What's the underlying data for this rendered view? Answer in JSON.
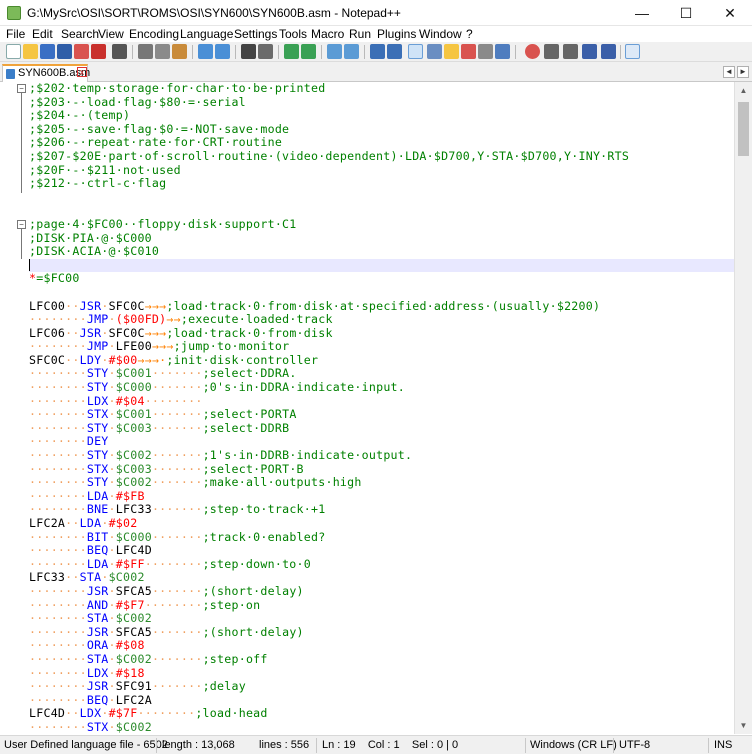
{
  "window": {
    "title": "G:\\MySrc\\OSI\\SORT\\ROMS\\OSI\\SYN600\\SYN600B.asm - Notepad++",
    "minimize": "—",
    "maximize": "☐",
    "close": "✕"
  },
  "menu": [
    "File",
    "Edit",
    "Search",
    "View",
    "Encoding",
    "Language",
    "Settings",
    "Tools",
    "Macro",
    "Run",
    "Plugins",
    "Window",
    "?"
  ],
  "tabs": [
    {
      "label": "SYN600B.asm",
      "close": "x"
    }
  ],
  "tab_arrows": {
    "left": "◄",
    "right": "►"
  },
  "editor": {
    "lines": [
      [
        [
          "c",
          ";$202·temp·storage·for·char·to·be·printed"
        ]
      ],
      [
        [
          "c",
          ";$203·-·load·flag·$80·=·serial"
        ]
      ],
      [
        [
          "c",
          ";$204·-·(temp)"
        ]
      ],
      [
        [
          "c",
          ";$205·-·save·flag·$0·=·NOT·save·mode"
        ]
      ],
      [
        [
          "c",
          ";$206·-·repeat·rate·for·CRT·routine"
        ]
      ],
      [
        [
          "c",
          ";$207-$20E·part·of·scroll·routine·(video·dependent)·LDA·$D700,Y·STA·$D700,Y·INY·RTS"
        ]
      ],
      [
        [
          "c",
          ";$20F·-·$211·not·used"
        ]
      ],
      [
        [
          "c",
          ";$212·-·ctrl-c·flag"
        ]
      ],
      [
        [
          "c",
          ""
        ]
      ],
      [
        [
          "c",
          ""
        ]
      ],
      [
        [
          "c",
          ";page·4·$FC00··floppy·disk·support·C1"
        ]
      ],
      [
        [
          "c",
          ";DISK·PIA·@·$C000"
        ]
      ],
      [
        [
          "c",
          ";DISK·ACIA·@·$C010"
        ]
      ],
      [
        [
          "caret",
          ""
        ]
      ],
      [
        [
          "o",
          "*"
        ],
        [
          "c",
          "=$FC00"
        ]
      ],
      [
        [
          "c",
          ""
        ]
      ],
      [
        [
          "l",
          "LFC00"
        ],
        [
          "ws",
          "··"
        ],
        [
          "k",
          "JSR"
        ],
        [
          "ws",
          "·"
        ],
        [
          "l",
          "SFC0C"
        ],
        [
          "t",
          "→→→"
        ],
        [
          "c",
          ";load·track·0·from·disk·at·specified·address·(usually·$2200)"
        ]
      ],
      [
        [
          "ws",
          "········"
        ],
        [
          "k",
          "JMP"
        ],
        [
          "ws",
          "·"
        ],
        [
          "o",
          "($00FD)"
        ],
        [
          "t",
          "→→"
        ],
        [
          "c",
          ";execute·loaded·track"
        ]
      ],
      [
        [
          "l",
          "LFC06"
        ],
        [
          "ws",
          "··"
        ],
        [
          "k",
          "JSR"
        ],
        [
          "ws",
          "·"
        ],
        [
          "l",
          "SFC0C"
        ],
        [
          "t",
          "→→→"
        ],
        [
          "c",
          ";load·track·0·from·disk"
        ]
      ],
      [
        [
          "ws",
          "········"
        ],
        [
          "k",
          "JMP"
        ],
        [
          "ws",
          "·"
        ],
        [
          "l",
          "LFE00"
        ],
        [
          "t",
          "→→→"
        ],
        [
          "c",
          ";jump·to·monitor"
        ]
      ],
      [
        [
          "l",
          "SFC0C"
        ],
        [
          "ws",
          "··"
        ],
        [
          "k",
          "LDY"
        ],
        [
          "ws",
          "·"
        ],
        [
          "o",
          "#$00"
        ],
        [
          "t",
          "→→→·"
        ],
        [
          "c",
          ";init·disk·controller"
        ]
      ],
      [
        [
          "ws",
          "········"
        ],
        [
          "k",
          "STY"
        ],
        [
          "ws",
          "·"
        ],
        [
          "n",
          "$C001"
        ],
        [
          "ws",
          "·······"
        ],
        [
          "c",
          ";select·DDRA."
        ]
      ],
      [
        [
          "ws",
          "········"
        ],
        [
          "k",
          "STY"
        ],
        [
          "ws",
          "·"
        ],
        [
          "n",
          "$C000"
        ],
        [
          "ws",
          "·······"
        ],
        [
          "c",
          ";0's·in·DDRA·indicate·input."
        ]
      ],
      [
        [
          "ws",
          "········"
        ],
        [
          "k",
          "LDX"
        ],
        [
          "ws",
          "·"
        ],
        [
          "o",
          "#$04"
        ],
        [
          "ws",
          "········"
        ]
      ],
      [
        [
          "ws",
          "········"
        ],
        [
          "k",
          "STX"
        ],
        [
          "ws",
          "·"
        ],
        [
          "n",
          "$C001"
        ],
        [
          "ws",
          "·······"
        ],
        [
          "c",
          ";select·PORTA"
        ]
      ],
      [
        [
          "ws",
          "········"
        ],
        [
          "k",
          "STY"
        ],
        [
          "ws",
          "·"
        ],
        [
          "n",
          "$C003"
        ],
        [
          "ws",
          "·······"
        ],
        [
          "c",
          ";select·DDRB"
        ]
      ],
      [
        [
          "ws",
          "········"
        ],
        [
          "k",
          "DEY"
        ]
      ],
      [
        [
          "ws",
          "········"
        ],
        [
          "k",
          "STY"
        ],
        [
          "ws",
          "·"
        ],
        [
          "n",
          "$C002"
        ],
        [
          "ws",
          "·······"
        ],
        [
          "c",
          ";1's·in·DDRB·indicate·output."
        ]
      ],
      [
        [
          "ws",
          "········"
        ],
        [
          "k",
          "STX"
        ],
        [
          "ws",
          "·"
        ],
        [
          "n",
          "$C003"
        ],
        [
          "ws",
          "·······"
        ],
        [
          "c",
          ";select·PORT·B"
        ]
      ],
      [
        [
          "ws",
          "········"
        ],
        [
          "k",
          "STY"
        ],
        [
          "ws",
          "·"
        ],
        [
          "n",
          "$C002"
        ],
        [
          "ws",
          "·······"
        ],
        [
          "c",
          ";make·all·outputs·high"
        ]
      ],
      [
        [
          "ws",
          "········"
        ],
        [
          "k",
          "LDA"
        ],
        [
          "ws",
          "·"
        ],
        [
          "o",
          "#$FB"
        ]
      ],
      [
        [
          "ws",
          "········"
        ],
        [
          "k",
          "BNE"
        ],
        [
          "ws",
          "·"
        ],
        [
          "l",
          "LFC33"
        ],
        [
          "ws",
          "·······"
        ],
        [
          "c",
          ";step·to·track·+1"
        ]
      ],
      [
        [
          "l",
          "LFC2A"
        ],
        [
          "ws",
          "··"
        ],
        [
          "k",
          "LDA"
        ],
        [
          "ws",
          "·"
        ],
        [
          "o",
          "#$02"
        ]
      ],
      [
        [
          "ws",
          "········"
        ],
        [
          "k",
          "BIT"
        ],
        [
          "ws",
          "·"
        ],
        [
          "n",
          "$C000"
        ],
        [
          "ws",
          "·······"
        ],
        [
          "c",
          ";track·0·enabled?"
        ]
      ],
      [
        [
          "ws",
          "········"
        ],
        [
          "k",
          "BEQ"
        ],
        [
          "ws",
          "·"
        ],
        [
          "l",
          "LFC4D"
        ]
      ],
      [
        [
          "ws",
          "········"
        ],
        [
          "k",
          "LDA"
        ],
        [
          "ws",
          "·"
        ],
        [
          "o",
          "#$FF"
        ],
        [
          "ws",
          "········"
        ],
        [
          "c",
          ";step·down·to·0"
        ]
      ],
      [
        [
          "l",
          "LFC33"
        ],
        [
          "ws",
          "··"
        ],
        [
          "k",
          "STA"
        ],
        [
          "ws",
          "·"
        ],
        [
          "n",
          "$C002"
        ]
      ],
      [
        [
          "ws",
          "········"
        ],
        [
          "k",
          "JSR"
        ],
        [
          "ws",
          "·"
        ],
        [
          "l",
          "SFCA5"
        ],
        [
          "ws",
          "·······"
        ],
        [
          "c",
          ";(short·delay)"
        ]
      ],
      [
        [
          "ws",
          "········"
        ],
        [
          "k",
          "AND"
        ],
        [
          "ws",
          "·"
        ],
        [
          "o",
          "#$F7"
        ],
        [
          "ws",
          "········"
        ],
        [
          "c",
          ";step·on"
        ]
      ],
      [
        [
          "ws",
          "········"
        ],
        [
          "k",
          "STA"
        ],
        [
          "ws",
          "·"
        ],
        [
          "n",
          "$C002"
        ]
      ],
      [
        [
          "ws",
          "········"
        ],
        [
          "k",
          "JSR"
        ],
        [
          "ws",
          "·"
        ],
        [
          "l",
          "SFCA5"
        ],
        [
          "ws",
          "·······"
        ],
        [
          "c",
          ";(short·delay)"
        ]
      ],
      [
        [
          "ws",
          "········"
        ],
        [
          "k",
          "ORA"
        ],
        [
          "ws",
          "·"
        ],
        [
          "o",
          "#$08"
        ]
      ],
      [
        [
          "ws",
          "········"
        ],
        [
          "k",
          "STA"
        ],
        [
          "ws",
          "·"
        ],
        [
          "n",
          "$C002"
        ],
        [
          "ws",
          "·······"
        ],
        [
          "c",
          ";step·off"
        ]
      ],
      [
        [
          "ws",
          "········"
        ],
        [
          "k",
          "LDX"
        ],
        [
          "ws",
          "·"
        ],
        [
          "o",
          "#$18"
        ]
      ],
      [
        [
          "ws",
          "········"
        ],
        [
          "k",
          "JSR"
        ],
        [
          "ws",
          "·"
        ],
        [
          "l",
          "SFC91"
        ],
        [
          "ws",
          "·······"
        ],
        [
          "c",
          ";delay"
        ]
      ],
      [
        [
          "ws",
          "········"
        ],
        [
          "k",
          "BEQ"
        ],
        [
          "ws",
          "·"
        ],
        [
          "l",
          "LFC2A"
        ]
      ],
      [
        [
          "l",
          "LFC4D"
        ],
        [
          "ws",
          "··"
        ],
        [
          "k",
          "LDX"
        ],
        [
          "ws",
          "·"
        ],
        [
          "o",
          "#$7F"
        ],
        [
          "ws",
          "········"
        ],
        [
          "c",
          ";load·head"
        ]
      ],
      [
        [
          "ws",
          "········"
        ],
        [
          "k",
          "STX"
        ],
        [
          "ws",
          "·"
        ],
        [
          "n",
          "$C002"
        ]
      ]
    ],
    "current_line_index": 13
  },
  "scrollbar": {
    "up": "▲",
    "down": "▼"
  },
  "status": {
    "language": "User Defined language file - 6502",
    "length": "length : 13,068",
    "lines": "lines : 556",
    "position": "Ln : 19    Col : 1    Sel : 0 | 0",
    "eol": "Windows (CR LF)",
    "encoding": "UTF-8",
    "mode": "INS"
  },
  "colors": {
    "comment": "#008000",
    "keyword": "#0000ff",
    "operand": "#ff0000",
    "tab_arrow": "#ff8000",
    "whitespace_dot": "#f0a060",
    "current_line": "#e8e8ff",
    "tab_accent": "#f0a33b"
  }
}
